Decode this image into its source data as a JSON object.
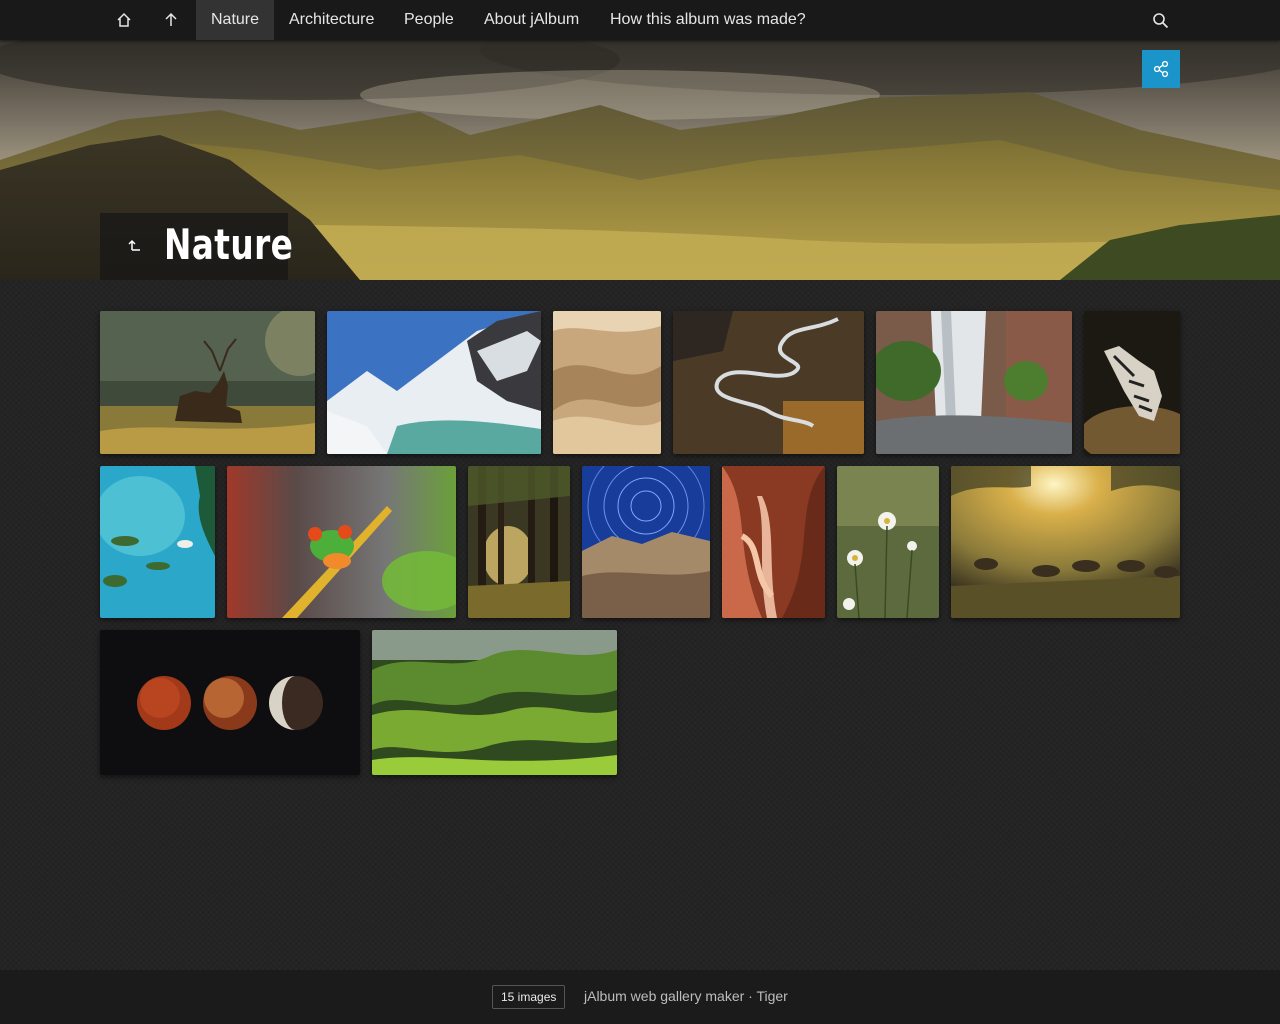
{
  "topbar": {
    "home_icon": "home-icon",
    "up_icon": "arrow-up-icon",
    "search_icon": "search-icon",
    "nav": [
      "Nature",
      "Architecture",
      "People",
      "About jAlbum",
      "How this album was made?"
    ],
    "active": "Nature"
  },
  "hero": {
    "title": "Nature",
    "up_icon": "level-up-icon",
    "share_icon": "share-icon",
    "share_color": "#1a94c9"
  },
  "thumbnails": [
    {
      "subject": "deer",
      "icon": "deer-thumbnail"
    },
    {
      "subject": "snowy-mountain-lake",
      "icon": "mountain-lake-thumbnail"
    },
    {
      "subject": "sand-dunes",
      "icon": "sand-dunes-thumbnail"
    },
    {
      "subject": "winding-river",
      "icon": "winding-river-thumbnail"
    },
    {
      "subject": "waterfall",
      "icon": "waterfall-thumbnail"
    },
    {
      "subject": "zebra",
      "icon": "zebra-thumbnail"
    },
    {
      "subject": "tropical-islands",
      "icon": "islands-thumbnail"
    },
    {
      "subject": "tree-frog",
      "icon": "frog-thumbnail"
    },
    {
      "subject": "forest-sunlight",
      "icon": "forest-thumbnail"
    },
    {
      "subject": "star-trails",
      "icon": "star-trails-thumbnail"
    },
    {
      "subject": "slot-canyon",
      "icon": "canyon-thumbnail"
    },
    {
      "subject": "daisies",
      "icon": "daisies-thumbnail"
    },
    {
      "subject": "deer-at-sunset",
      "icon": "deer-herd-thumbnail"
    },
    {
      "subject": "lunar-eclipse",
      "icon": "moon-phases-thumbnail"
    },
    {
      "subject": "green-hills",
      "icon": "green-hills-thumbnail"
    }
  ],
  "footer": {
    "count": "15 images",
    "credits": "jAlbum web gallery maker · Tiger"
  }
}
